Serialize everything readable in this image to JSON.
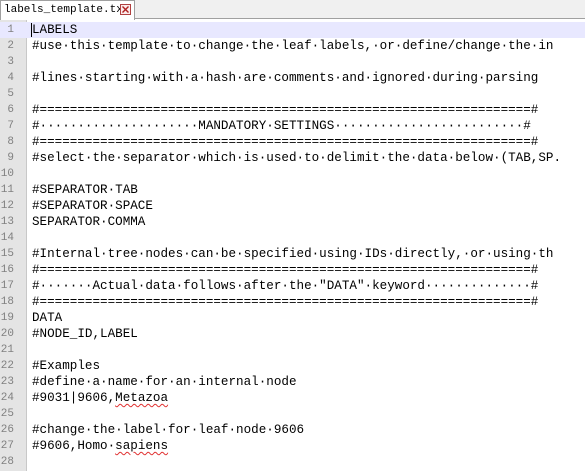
{
  "tab": {
    "filename": "labels_template.txt"
  },
  "lines": [
    {
      "num": "1",
      "text": "LABELS"
    },
    {
      "num": "2",
      "text": "#use·this·template·to·change·the·leaf·labels,·or·define/change·the·in"
    },
    {
      "num": "3",
      "text": ""
    },
    {
      "num": "4",
      "text": "#lines·starting·with·a·hash·are·comments·and·ignored·during·parsing"
    },
    {
      "num": "5",
      "text": ""
    },
    {
      "num": "6",
      "text": "#=================================================================#"
    },
    {
      "num": "7",
      "text": "#·····················MANDATORY·SETTINGS·························#"
    },
    {
      "num": "8",
      "text": "#=================================================================#"
    },
    {
      "num": "9",
      "text": "#select·the·separator·which·is·used·to·delimit·the·data·below·(TAB,SP."
    },
    {
      "num": "10",
      "text": ""
    },
    {
      "num": "11",
      "text": "#SEPARATOR·TAB"
    },
    {
      "num": "12",
      "text": "#SEPARATOR·SPACE"
    },
    {
      "num": "13",
      "text": "SEPARATOR·COMMA"
    },
    {
      "num": "14",
      "text": ""
    },
    {
      "num": "15",
      "text": "#Internal·tree·nodes·can·be·specified·using·IDs·directly,·or·using·th"
    },
    {
      "num": "16",
      "text": "#=================================================================#"
    },
    {
      "num": "17",
      "text": "#·······Actual·data·follows·after·the·\"DATA\"·keyword··············#"
    },
    {
      "num": "18",
      "text": "#=================================================================#"
    },
    {
      "num": "19",
      "text": "DATA"
    },
    {
      "num": "20",
      "text": "#NODE_ID,LABEL"
    },
    {
      "num": "21",
      "text": ""
    },
    {
      "num": "22",
      "text": "#Examples"
    },
    {
      "num": "23",
      "text": "#define·a·name·for·an·internal·node"
    },
    {
      "num": "24a",
      "text": "#9031|9606,",
      "num_display": "24",
      "squiggle": "Metazoa"
    },
    {
      "num": "25",
      "text": ""
    },
    {
      "num": "26",
      "text": "#change·the·label·for·leaf·node·9606"
    },
    {
      "num": "27a",
      "text": "#9606,Homo·",
      "num_display": "27",
      "squiggle": "sapiens"
    },
    {
      "num": "28",
      "text": ""
    }
  ],
  "colors": {
    "gutter": "#e4e4e4",
    "line_number": "#808080",
    "current_line": "#e8e8ff",
    "spellcheck": "#e03030"
  },
  "icons": {
    "tab_close": "close-icon"
  }
}
